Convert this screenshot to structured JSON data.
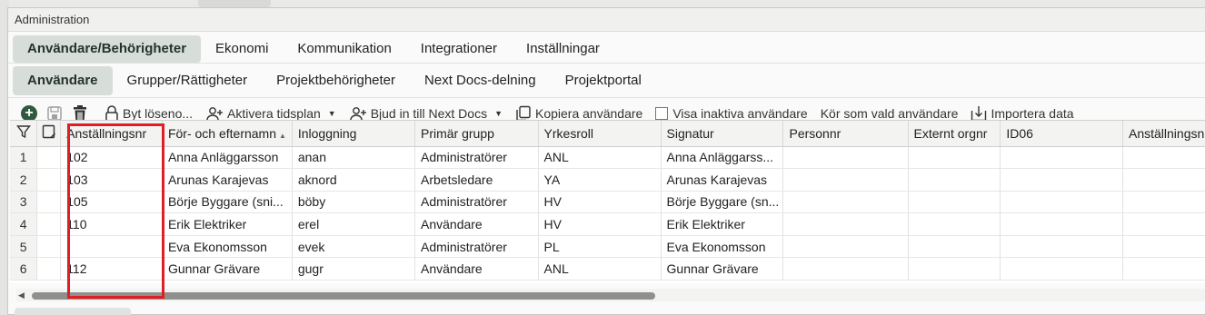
{
  "window": {
    "title": "Administration"
  },
  "tabs_level1": [
    {
      "label": "Användare/Behörigheter",
      "active": true
    },
    {
      "label": "Ekonomi",
      "active": false
    },
    {
      "label": "Kommunikation",
      "active": false
    },
    {
      "label": "Integrationer",
      "active": false
    },
    {
      "label": "Inställningar",
      "active": false
    }
  ],
  "tabs_level2": [
    {
      "label": "Användare",
      "active": true
    },
    {
      "label": "Grupper/Rättigheter",
      "active": false
    },
    {
      "label": "Projektbehörigheter",
      "active": false
    },
    {
      "label": "Next Docs-delning",
      "active": false
    },
    {
      "label": "Projektportal",
      "active": false
    }
  ],
  "toolbar": {
    "change_password": "Byt löseno...",
    "activate_schedule": "Aktivera tidsplan",
    "invite_next_docs": "Bjud in till Next Docs",
    "copy_user": "Kopiera användare",
    "show_inactive": "Visa inaktiva användare",
    "run_as_user": "Kör som vald användare",
    "import_data": "Importera data"
  },
  "grid": {
    "columns": [
      "Anställningsnr",
      "För- och efternamn",
      "Inloggning",
      "Primär grupp",
      "Yrkesroll",
      "Signatur",
      "Personnr",
      "Externt orgnr",
      "ID06",
      "Anställningsnr"
    ],
    "sorted_column": "För- och efternamn",
    "rows": [
      {
        "n": "1",
        "cells": [
          "102",
          "Anna Anläggarsson",
          "anan",
          "Administratörer",
          "ANL",
          "Anna Anläggarss...",
          "",
          "",
          "",
          ""
        ]
      },
      {
        "n": "2",
        "cells": [
          "103",
          "Arunas Karajevas",
          "aknord",
          "Arbetsledare",
          "YA",
          "Arunas Karajevas",
          "",
          "",
          "",
          ""
        ]
      },
      {
        "n": "3",
        "cells": [
          "105",
          "Börje Byggare (sni...",
          "böby",
          "Administratörer",
          "HV",
          "Börje Byggare (sn...",
          "",
          "",
          "",
          ""
        ]
      },
      {
        "n": "4",
        "cells": [
          "110",
          "Erik Elektriker",
          "erel",
          "Användare",
          "HV",
          "Erik Elektriker",
          "",
          "",
          "",
          ""
        ]
      },
      {
        "n": "5",
        "cells": [
          "",
          "Eva Ekonomsson",
          "evek",
          "Administratörer",
          "PL",
          "Eva Ekonomsson",
          "",
          "",
          "",
          ""
        ]
      },
      {
        "n": "6",
        "cells": [
          "112",
          "Gunnar Grävare",
          "gugr",
          "Användare",
          "ANL",
          "Gunnar Grävare",
          "",
          "",
          "",
          ""
        ]
      }
    ]
  },
  "colors": {
    "accent": "#2f5a3f",
    "highlight_box": "#e01e26",
    "active_tab": "#d7ddd9"
  }
}
